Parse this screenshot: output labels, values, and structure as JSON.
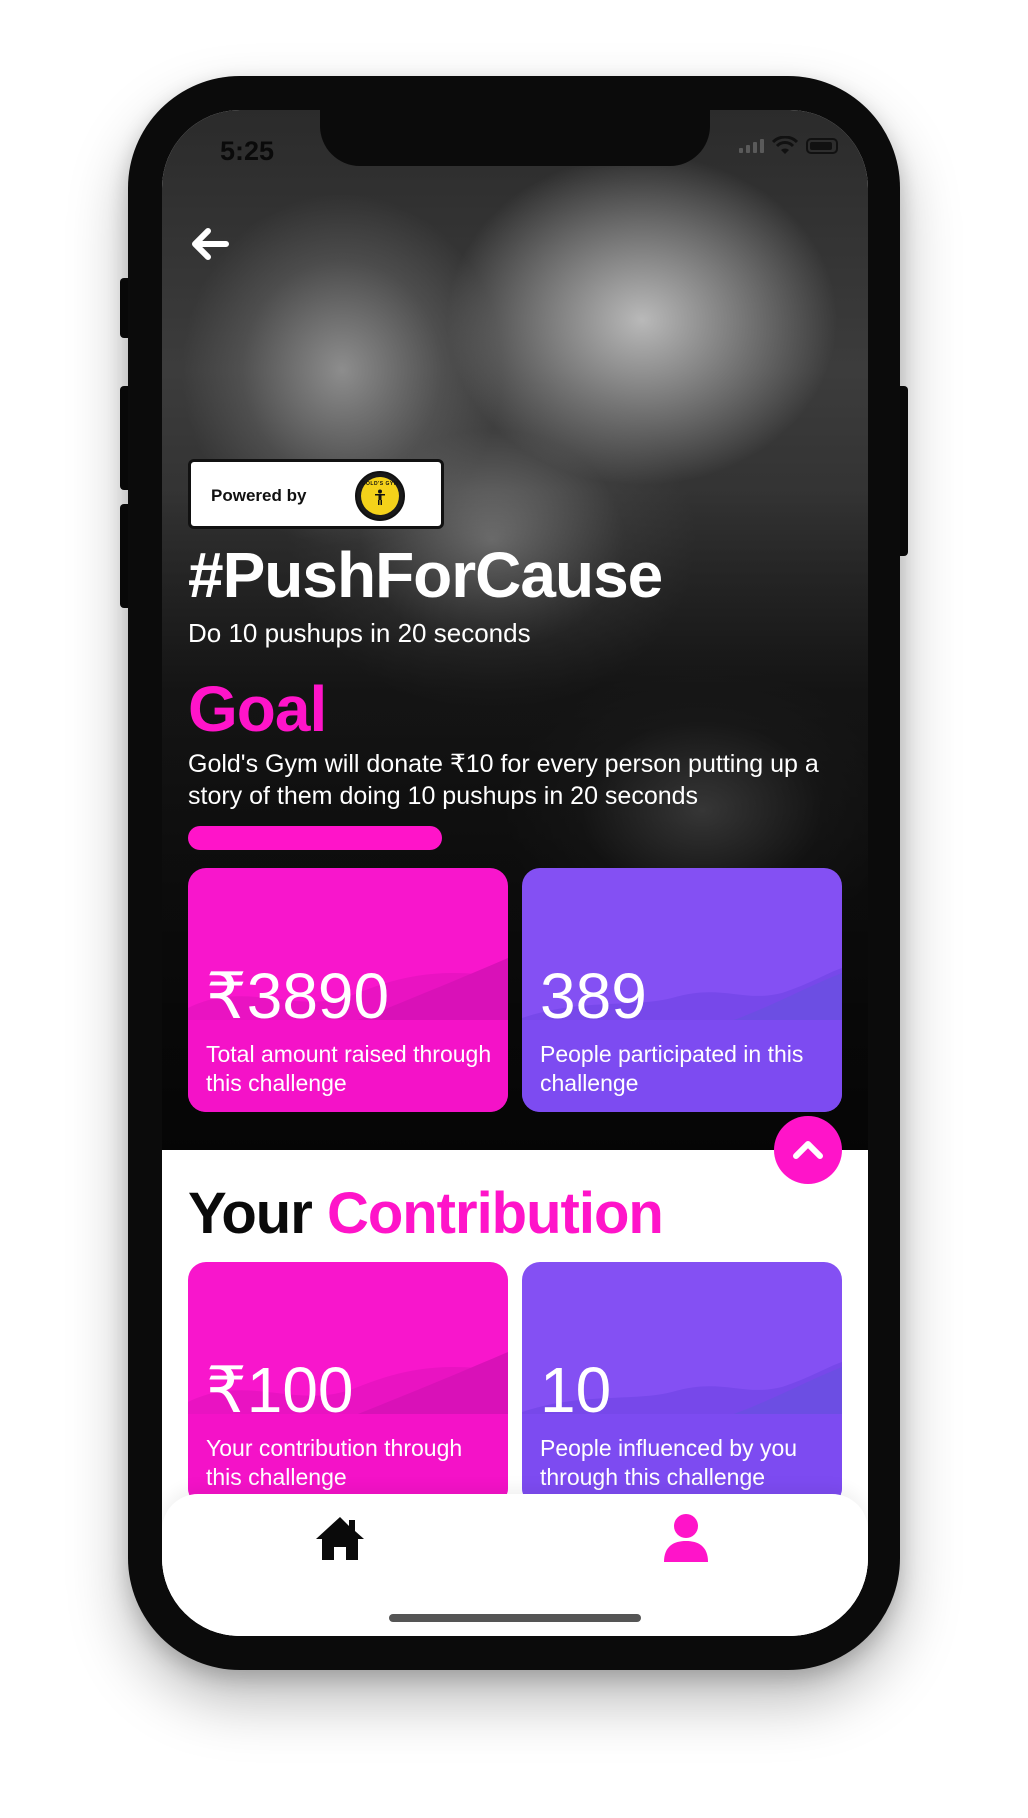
{
  "status_bar": {
    "time": "5:25",
    "icons": [
      "signal-icon",
      "wifi-icon",
      "battery-icon"
    ]
  },
  "nav": {
    "back_icon": "arrow-left-icon"
  },
  "sponsor": {
    "powered_by_label": "Powered by",
    "logo_text": "GOLD'S GYM",
    "logo_icon": "golds-gym-logo"
  },
  "challenge": {
    "title": "#PushForCause",
    "subtitle": "Do 10 pushups in 20 seconds"
  },
  "goal": {
    "heading": "Goal",
    "description": "Gold's Gym will donate ₹10 for every person putting up a story of them doing 10 pushups in 20 seconds",
    "progress_color": "#ff14c9"
  },
  "stats": [
    {
      "value": "₹3890",
      "label": "Total amount raised through this challenge",
      "color": "#f816cc"
    },
    {
      "value": "389",
      "label": "People participated in this challenge",
      "color": "#8450f3"
    }
  ],
  "fab": {
    "icon": "chevron-up-icon"
  },
  "contribution": {
    "title_part1": "Your",
    "title_part2": "Contribution",
    "cards": [
      {
        "value": "₹100",
        "label": "Your contribution through this challenge",
        "color": "#f816cc"
      },
      {
        "value": "10",
        "label": "People influenced by you through this challenge",
        "color": "#8450f3"
      }
    ]
  },
  "tab_bar": {
    "items": [
      {
        "icon": "home-icon",
        "active": false
      },
      {
        "icon": "profile-icon",
        "active": true
      }
    ],
    "active_color": "#ff14c9"
  },
  "colors": {
    "accent_pink": "#ff14c9",
    "accent_purple": "#8450f3"
  }
}
